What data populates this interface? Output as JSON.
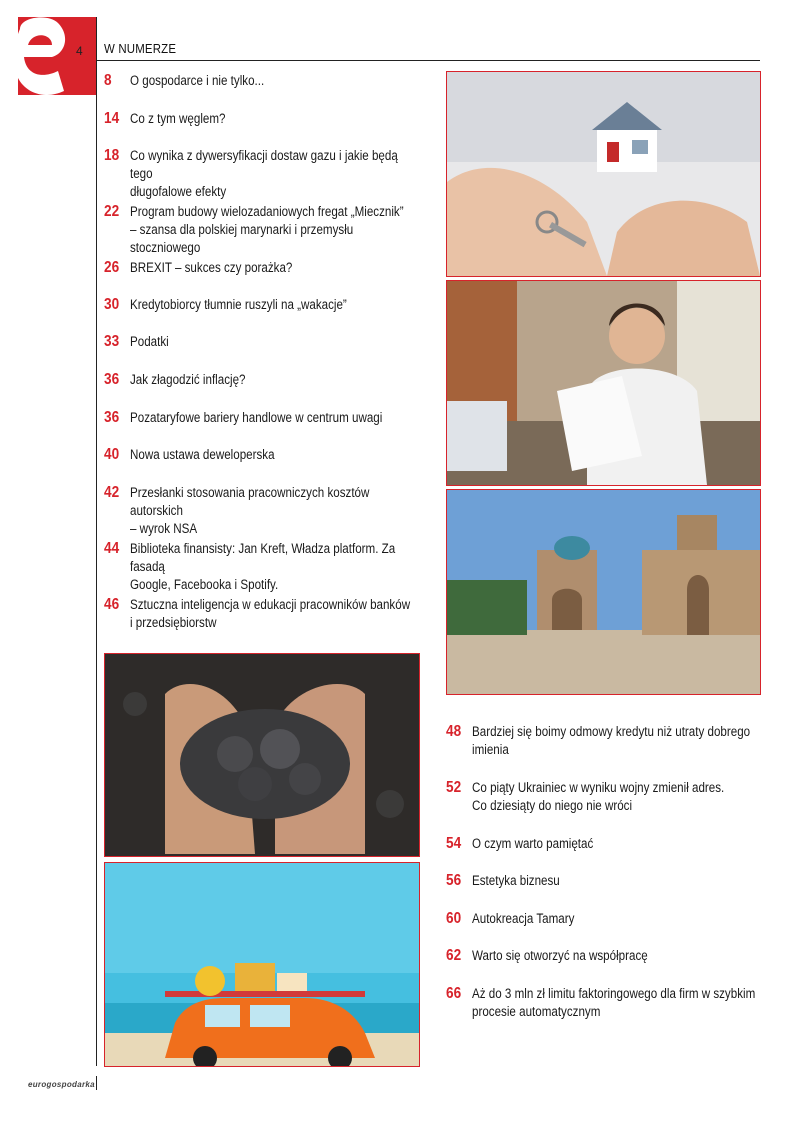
{
  "header": {
    "page_number": "4",
    "section": "W NUMERZE"
  },
  "footer": {
    "brand": "eurogospodarka"
  },
  "colors": {
    "accent": "#d7232b"
  },
  "toc_left": [
    {
      "page": "8",
      "title": "O gospodarce i nie tylko..."
    },
    {
      "page": "14",
      "title": "Co z tym węglem?"
    },
    {
      "page": "18",
      "title": "Co wynika z dywersyfikacji dostaw gazu i jakie będą tego\ndługofalowe efekty"
    },
    {
      "page": "22",
      "title": "Program budowy wielozadaniowych fregat „Miecznik”\n– szansa dla polskiej marynarki i przemysłu stoczniowego"
    },
    {
      "page": "26",
      "title": "BREXIT – sukces czy porażka?"
    },
    {
      "page": "30",
      "title": "Kredytobiorcy tłumnie ruszyli na „wakacje”"
    },
    {
      "page": "33",
      "title": "Podatki"
    },
    {
      "page": "36",
      "title": "Jak złagodzić inflację?"
    },
    {
      "page": "36",
      "title": "Pozataryfowe bariery handlowe w centrum uwagi"
    },
    {
      "page": "40",
      "title": "Nowa ustawa deweloperska"
    },
    {
      "page": "42",
      "title": "Przesłanki stosowania pracowniczych kosztów autorskich\n– wyrok NSA"
    },
    {
      "page": "44",
      "title": "Biblioteka finansisty: Jan Kreft, Władza platform. Za fasadą\nGoogle, Facebooka i Spotify."
    },
    {
      "page": "46",
      "title": "Sztuczna inteligencja w edukacji pracowników banków\ni przedsiębiorstw"
    }
  ],
  "toc_right": [
    {
      "page": "48",
      "title": "Bardziej się boimy odmowy kredytu niż utraty dobrego\nimienia"
    },
    {
      "page": "52",
      "title": "Co piąty Ukrainiec w wyniku wojny zmienił adres.\nCo dziesiąty do niego nie wróci"
    },
    {
      "page": "54",
      "title": "O czym warto pamiętać"
    },
    {
      "page": "56",
      "title": "Estetyka biznesu"
    },
    {
      "page": "60",
      "title": "Autokreacja Tamary"
    },
    {
      "page": "62",
      "title": "Warto się otworzyć na współpracę"
    },
    {
      "page": "66",
      "title": "Aż do 3 mln zł limitu faktoringowego dla firm w szybkim\nprocesie automatycznym"
    }
  ]
}
